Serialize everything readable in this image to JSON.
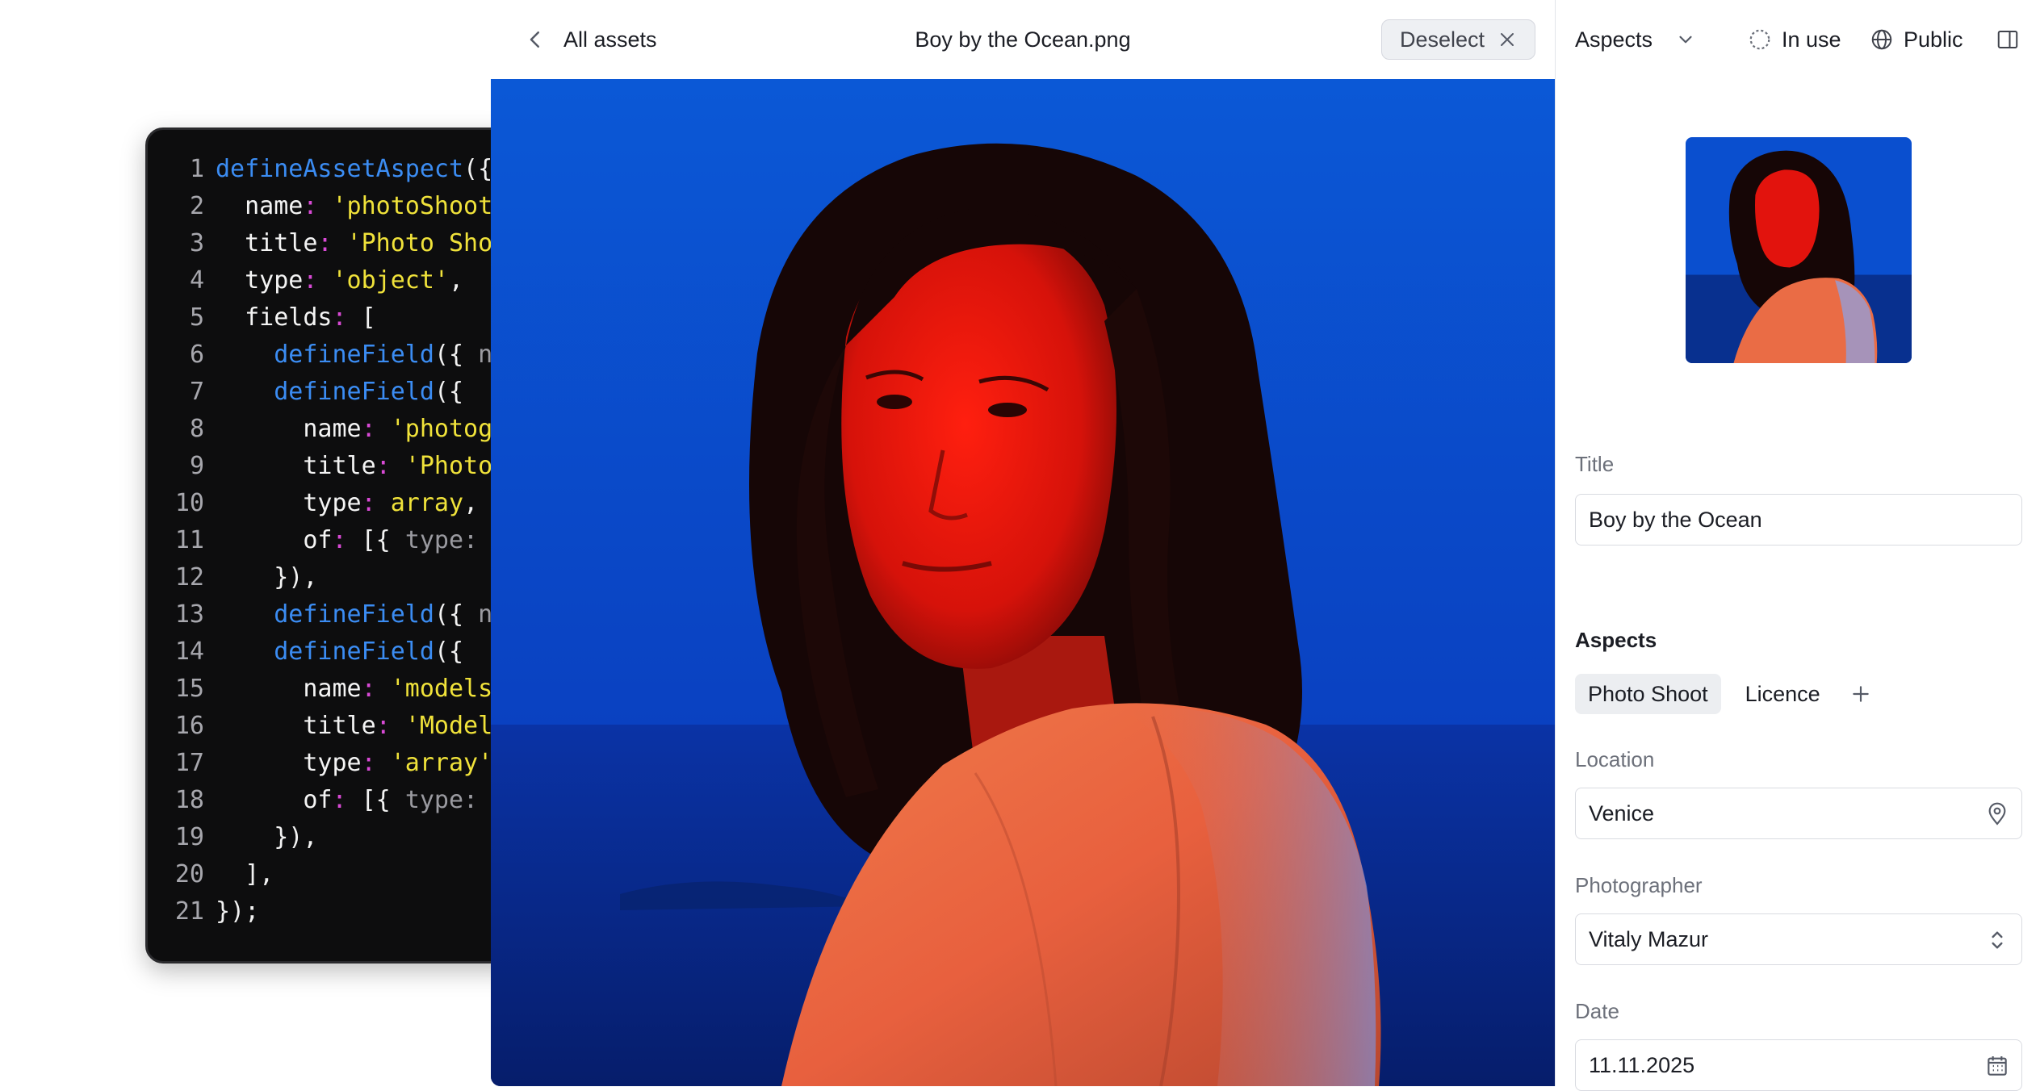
{
  "header": {
    "back_label": "All assets",
    "file_title": "Boy by the Ocean.png",
    "deselect_label": "Deselect"
  },
  "sidebar": {
    "aspects_dropdown": "Aspects",
    "in_use_label": "In use",
    "visibility_label": "Public",
    "title_label": "Title",
    "title_value": "Boy by the Ocean",
    "aspects_heading": "Aspects",
    "aspect_tabs": [
      "Photo Shoot",
      "Licence"
    ],
    "location_label": "Location",
    "location_value": "Venice",
    "photographer_label": "Photographer",
    "photographer_value": "Vitaly Mazur",
    "date_label": "Date",
    "date_value": "11.11.2025"
  },
  "code_lines": [
    [
      [
        "fn",
        "defineAssetAspect"
      ],
      [
        "plain",
        "({"
      ]
    ],
    [
      [
        "key",
        "  name"
      ],
      [
        "pun",
        ":"
      ],
      [
        "plain",
        " "
      ],
      [
        "str",
        "'photoShoot"
      ]
    ],
    [
      [
        "key",
        "  title"
      ],
      [
        "pun",
        ":"
      ],
      [
        "plain",
        " "
      ],
      [
        "str",
        "'Photo Sho"
      ]
    ],
    [
      [
        "key",
        "  type"
      ],
      [
        "pun",
        ":"
      ],
      [
        "plain",
        " "
      ],
      [
        "str",
        "'object'"
      ],
      [
        "plain",
        ","
      ]
    ],
    [
      [
        "key",
        "  fields"
      ],
      [
        "pun",
        ":"
      ],
      [
        "plain",
        " ["
      ]
    ],
    [
      [
        "plain",
        "    "
      ],
      [
        "fn",
        "defineField"
      ],
      [
        "plain",
        "({ "
      ],
      [
        "dim",
        "n"
      ]
    ],
    [
      [
        "plain",
        "    "
      ],
      [
        "fn",
        "defineField"
      ],
      [
        "plain",
        "({"
      ]
    ],
    [
      [
        "key",
        "      name"
      ],
      [
        "pun",
        ":"
      ],
      [
        "plain",
        " "
      ],
      [
        "str",
        "'photog"
      ]
    ],
    [
      [
        "key",
        "      title"
      ],
      [
        "pun",
        ":"
      ],
      [
        "plain",
        " "
      ],
      [
        "str",
        "'Photo"
      ]
    ],
    [
      [
        "key",
        "      type"
      ],
      [
        "pun",
        ":"
      ],
      [
        "plain",
        " "
      ],
      [
        "str",
        "array"
      ],
      [
        "plain",
        ","
      ]
    ],
    [
      [
        "key",
        "      of"
      ],
      [
        "pun",
        ":"
      ],
      [
        "plain",
        " [{ "
      ],
      [
        "dim",
        "type:"
      ]
    ],
    [
      [
        "plain",
        "    }),"
      ]
    ],
    [
      [
        "plain",
        "    "
      ],
      [
        "fn",
        "defineField"
      ],
      [
        "plain",
        "({ "
      ],
      [
        "dim",
        "n"
      ]
    ],
    [
      [
        "plain",
        "    "
      ],
      [
        "fn",
        "defineField"
      ],
      [
        "plain",
        "({"
      ]
    ],
    [
      [
        "key",
        "      name"
      ],
      [
        "pun",
        ":"
      ],
      [
        "plain",
        " "
      ],
      [
        "str",
        "'models"
      ]
    ],
    [
      [
        "key",
        "      title"
      ],
      [
        "pun",
        ":"
      ],
      [
        "plain",
        " "
      ],
      [
        "str",
        "'Model"
      ]
    ],
    [
      [
        "key",
        "      type"
      ],
      [
        "pun",
        ":"
      ],
      [
        "plain",
        " "
      ],
      [
        "str",
        "'array'"
      ]
    ],
    [
      [
        "key",
        "      of"
      ],
      [
        "pun",
        ":"
      ],
      [
        "plain",
        " [{ "
      ],
      [
        "dim",
        "type:"
      ]
    ],
    [
      [
        "plain",
        "    }),"
      ]
    ],
    [
      [
        "plain",
        "  ],"
      ]
    ],
    [
      [
        "plain",
        "});"
      ]
    ]
  ],
  "colors": {
    "accent_dark": "#1b1d24",
    "code_bg": "#0d0d0e",
    "code_fn": "#3b8cf2",
    "code_str": "#f0e23a",
    "code_pun": "#d94ad6",
    "photo_blue": "#0a3fbf",
    "photo_red": "#e2130d"
  },
  "icons": {
    "back": "chevron-left-icon",
    "deselect": "close-icon",
    "aspects_dropdown": "chevron-down-icon",
    "in_use": "dashed-circle-icon",
    "public": "globe-icon",
    "panel": "panel-toggle-icon",
    "add_aspect": "plus-icon",
    "location": "map-pin-icon",
    "photographer": "chevron-up-down-icon",
    "date": "calendar-icon"
  }
}
